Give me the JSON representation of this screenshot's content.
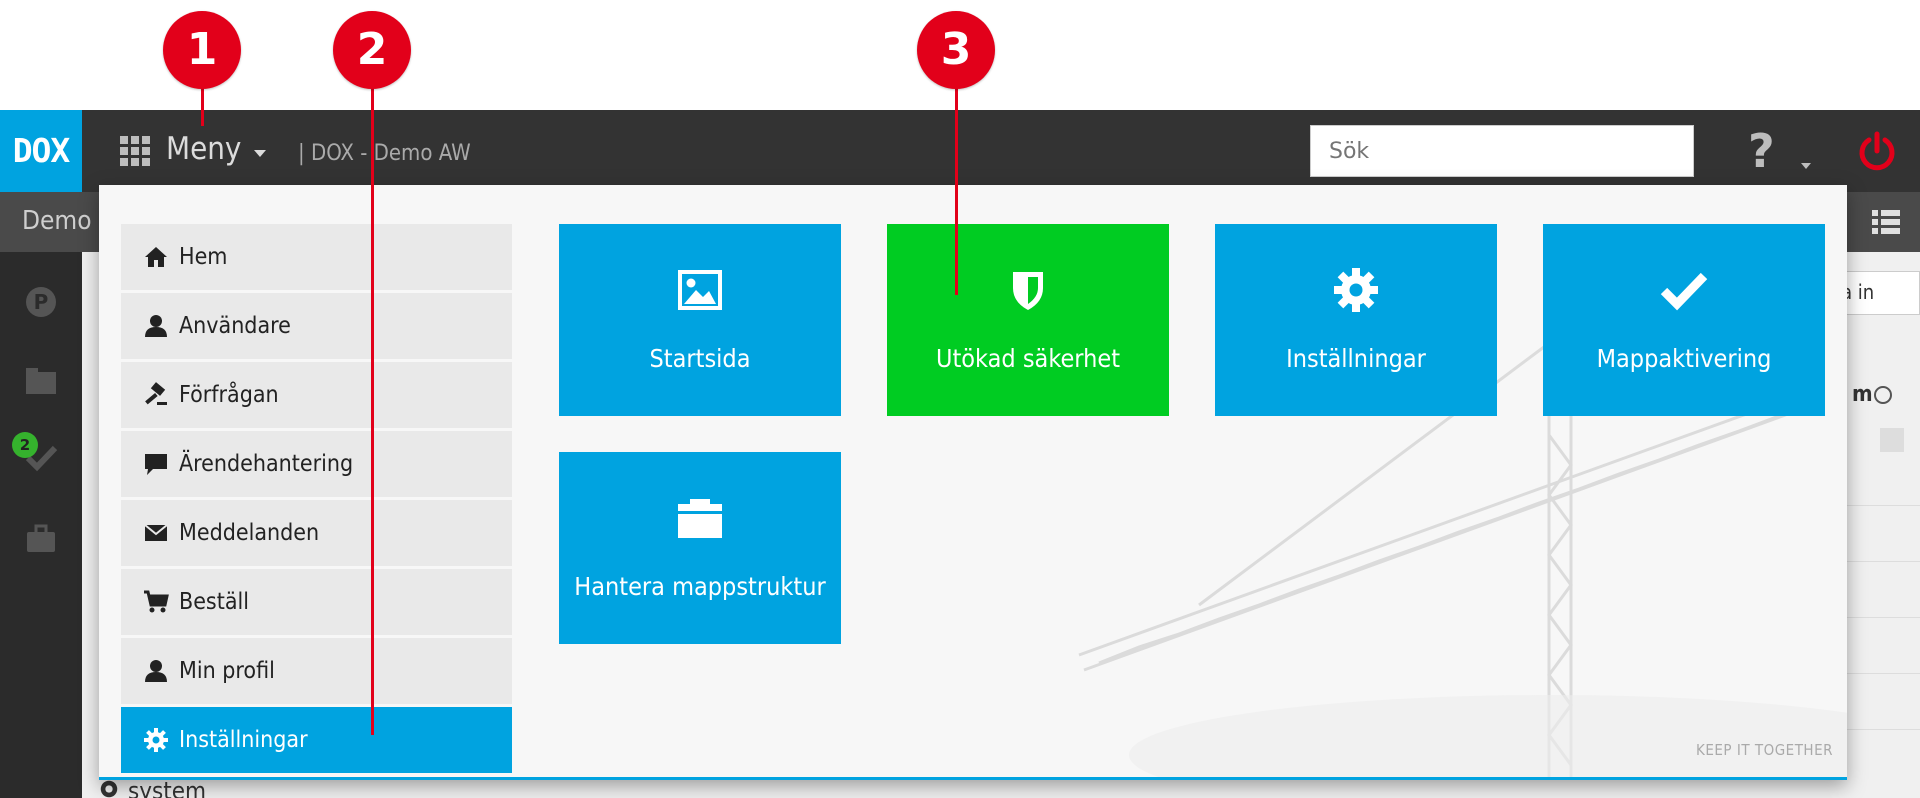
{
  "annotations": [
    {
      "number": "1"
    },
    {
      "number": "2"
    },
    {
      "number": "3"
    }
  ],
  "header": {
    "logo": "DOX",
    "menu_label": "Meny",
    "breadcrumb": "| DOX - Demo AW",
    "search_placeholder": "Sök",
    "help_symbol": "?"
  },
  "background": {
    "subbar_title": "Demo A",
    "button_fragment": "ka in",
    "column_fragment": "m",
    "badge_count": "2",
    "tree_item": "system"
  },
  "nav": {
    "items": [
      {
        "label": "Hem",
        "icon": "home-icon"
      },
      {
        "label": "Användare",
        "icon": "user-icon"
      },
      {
        "label": "Förfrågan",
        "icon": "gavel-icon"
      },
      {
        "label": "Ärendehantering",
        "icon": "comment-icon"
      },
      {
        "label": "Meddelanden",
        "icon": "envelope-icon"
      },
      {
        "label": "Beställ",
        "icon": "cart-icon"
      },
      {
        "label": "Min profil",
        "icon": "user-icon"
      },
      {
        "label": "Inställningar",
        "icon": "gear-icon",
        "active": true
      }
    ]
  },
  "tiles": [
    {
      "label": "Startsida",
      "icon": "image-icon",
      "color": "#00a3e0"
    },
    {
      "label": "Utökad säkerhet",
      "icon": "shield-icon",
      "color": "#00cc22"
    },
    {
      "label": "Inställningar",
      "icon": "gear-icon",
      "color": "#00a3e0"
    },
    {
      "label": "Mappaktivering",
      "icon": "check-icon",
      "color": "#00a3e0"
    },
    {
      "label": "Hantera mappstruktur",
      "icon": "folder-icon",
      "color": "#00a3e0"
    }
  ],
  "tagline": "KEEP IT TOGETHER",
  "colors": {
    "accent": "#00a3e0",
    "highlight": "#00cc22",
    "marker": "#e2001a",
    "topbar": "#333333"
  }
}
